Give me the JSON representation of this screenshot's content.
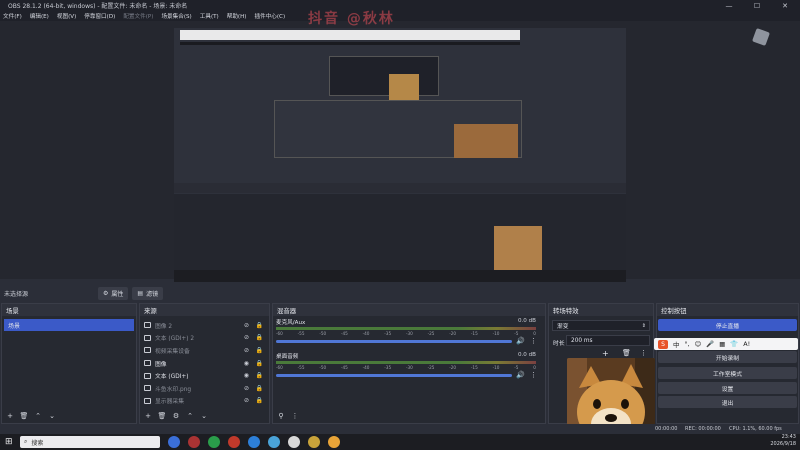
{
  "window": {
    "title": "OBS 28.1.2 (64-bit, windows) - 配置文件: 未命名 - 场景: 未命名"
  },
  "menu": [
    {
      "label": "文件(F)",
      "dim": false
    },
    {
      "label": "编辑(E)",
      "dim": false
    },
    {
      "label": "视图(V)",
      "dim": false
    },
    {
      "label": "停靠窗口(D)",
      "dim": false
    },
    {
      "label": "配置文件(P)",
      "dim": true
    },
    {
      "label": "场景集合(S)",
      "dim": false
    },
    {
      "label": "工具(T)",
      "dim": false
    },
    {
      "label": "帮助(H)",
      "dim": false
    },
    {
      "label": "插件中心(C)",
      "dim": false
    }
  ],
  "watermark": "抖音 @秋林",
  "toolbar": {
    "no_source": "未选择源",
    "properties": "属性",
    "filters": "滤镜"
  },
  "scenes": {
    "title": "场景",
    "items": [
      "场景"
    ]
  },
  "sources": {
    "title": "来源",
    "items": [
      {
        "name": "图像 2",
        "dim": true
      },
      {
        "name": "文本 (GDI+) 2",
        "dim": true
      },
      {
        "name": "视频采集设备",
        "dim": true
      },
      {
        "name": "图像",
        "dim": false
      },
      {
        "name": "文本 (GDI+)",
        "dim": false
      },
      {
        "name": "斗鱼水印.png",
        "dim": true
      },
      {
        "name": "显示器采集",
        "dim": true
      }
    ]
  },
  "mixer": {
    "title": "混音器",
    "channels": [
      {
        "name": "麦克风/Aux",
        "db": "0.0 dB",
        "level": 0.72
      },
      {
        "name": "桌面音频",
        "db": "0.0 dB",
        "level": 0.72
      }
    ],
    "scale": [
      "-60",
      "-55",
      "-50",
      "-45",
      "-40",
      "-35",
      "-30",
      "-25",
      "-20",
      "-15",
      "-10",
      "-5",
      "0"
    ]
  },
  "transitions": {
    "title": "转场特效",
    "type": "渐变",
    "duration_label": "时长",
    "duration": "200 ms"
  },
  "controls": {
    "title": "控制按钮",
    "buttons": [
      "停止直播",
      "开始录制",
      "工作室模式",
      "设置",
      "退出"
    ]
  },
  "ime": {
    "items": [
      "中",
      "°,",
      "☺",
      "🎤",
      "▦",
      "👕",
      "A!"
    ]
  },
  "status": {
    "live": "00:00:00",
    "rec": "REC: 00:00:00",
    "cpu": "CPU: 1.1%, 60.00 fps"
  },
  "taskbar": {
    "search_placeholder": "搜索",
    "time": "23:43",
    "date": "2026/9/18"
  }
}
